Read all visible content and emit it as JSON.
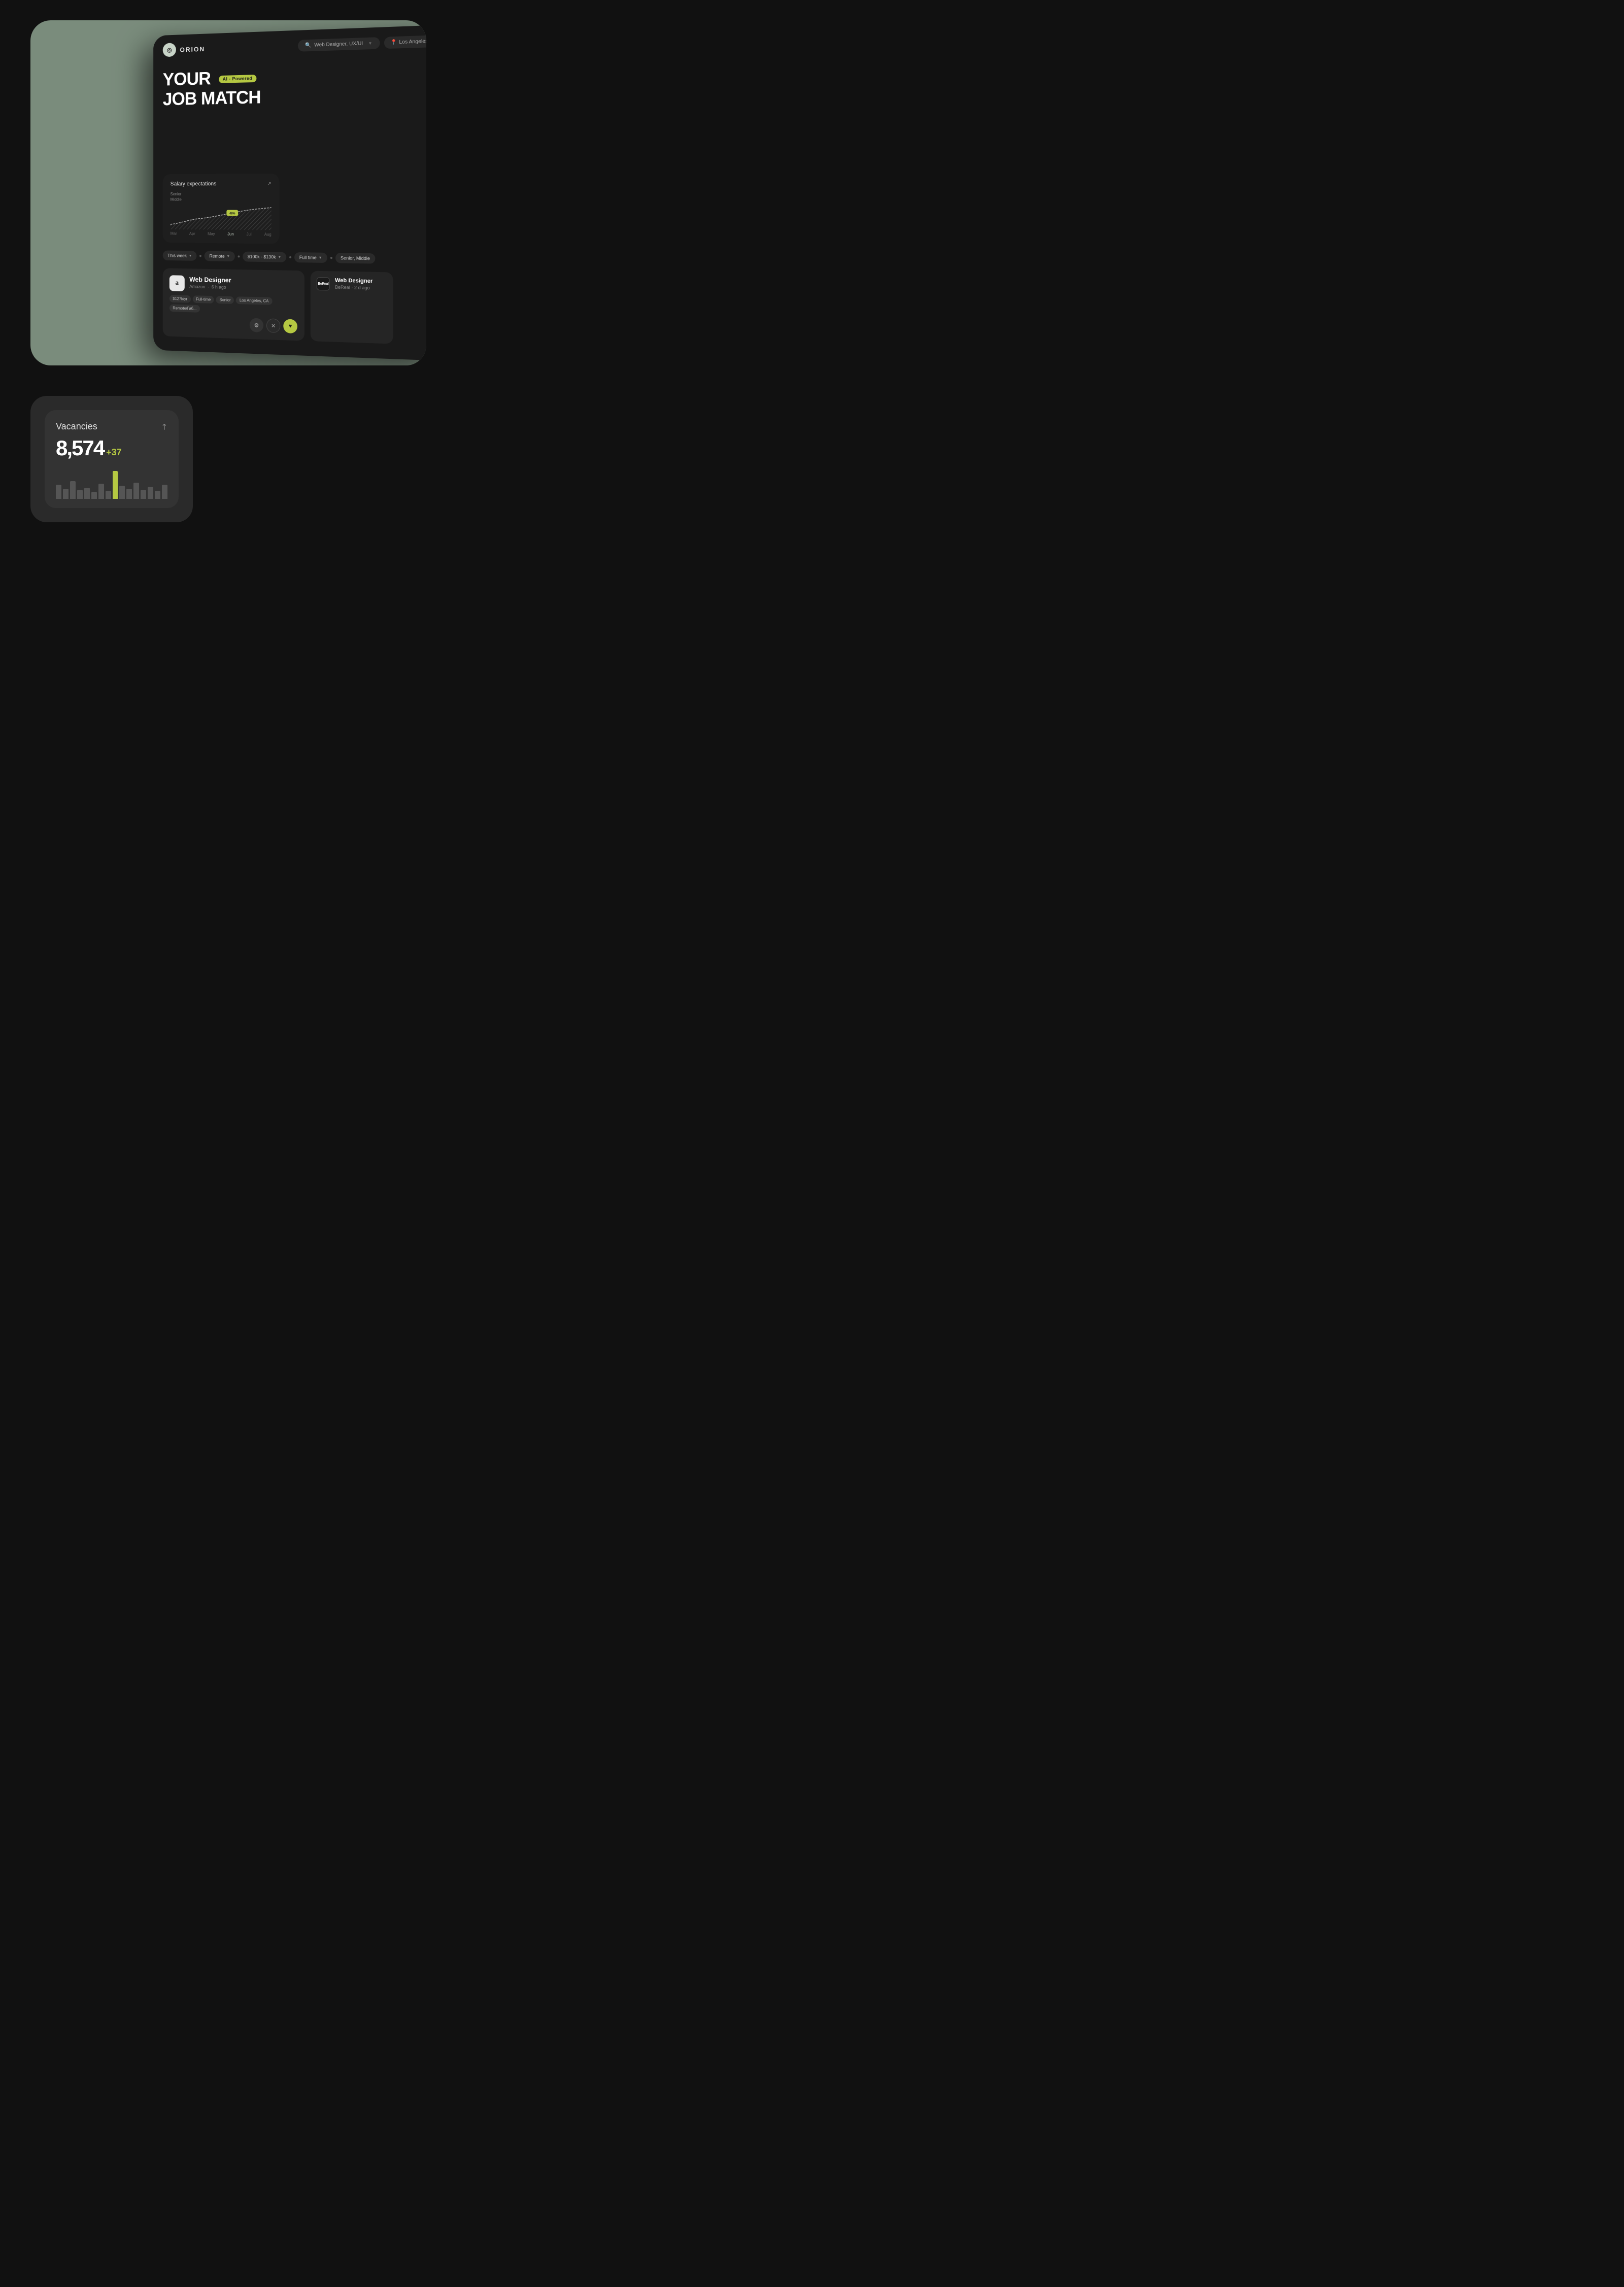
{
  "app": {
    "logo": "◎",
    "name": "ORION"
  },
  "header": {
    "search_placeholder": "Web Designer, UX/UI",
    "location": "Los Angeles",
    "location_icon": "📍"
  },
  "hero": {
    "line1": "YOUR",
    "line2": "JOB MATCH",
    "ai_badge": "AI - Powered"
  },
  "salary_card": {
    "title": "Salary expectations",
    "arrow": "↗",
    "senior_label": "Senior",
    "middle_label": "Middle",
    "months": [
      "Mar",
      "Apr",
      "May",
      "Jun",
      "Jul",
      "Aug"
    ],
    "active_month": "Jun",
    "percentage": "48%"
  },
  "filters": [
    {
      "label": "This week",
      "has_chevron": true
    },
    {
      "label": "Remote",
      "has_chevron": true
    },
    {
      "label": "$100k - $130k",
      "has_chevron": true
    },
    {
      "label": "Full time",
      "has_chevron": true
    },
    {
      "label": "Senior, Middle",
      "has_chevron": false
    }
  ],
  "jobs": [
    {
      "id": 1,
      "title": "Web Designer",
      "company": "Amazon",
      "time_ago": "6 h ago",
      "logo_text": "a",
      "tags": [
        "$127k/yr",
        "Full-time",
        "Senior",
        "Los Angeles, CA",
        "Remote/Гиб..."
      ],
      "actions": [
        "filter",
        "close",
        "like"
      ]
    },
    {
      "id": 2,
      "title": "Web Designer",
      "company": "BeReal",
      "time_ago": "2 d ago",
      "logo_text": "BeReal",
      "tags": []
    }
  ],
  "vacancies_widget": {
    "title": "Vacancies",
    "arrow": "↗",
    "count": "8,574",
    "delta": "+37",
    "bars": [
      {
        "height": 28,
        "type": "dim"
      },
      {
        "height": 20,
        "type": "dim"
      },
      {
        "height": 35,
        "type": "dim"
      },
      {
        "height": 18,
        "type": "dim"
      },
      {
        "height": 22,
        "type": "dim"
      },
      {
        "height": 14,
        "type": "dim"
      },
      {
        "height": 30,
        "type": "dim"
      },
      {
        "height": 16,
        "type": "dim"
      },
      {
        "height": 55,
        "type": "highlight"
      },
      {
        "height": 26,
        "type": "dim"
      },
      {
        "height": 20,
        "type": "dim"
      },
      {
        "height": 32,
        "type": "dim"
      },
      {
        "height": 18,
        "type": "dim"
      },
      {
        "height": 24,
        "type": "dim"
      },
      {
        "height": 16,
        "type": "dim"
      },
      {
        "height": 28,
        "type": "dim"
      }
    ]
  }
}
